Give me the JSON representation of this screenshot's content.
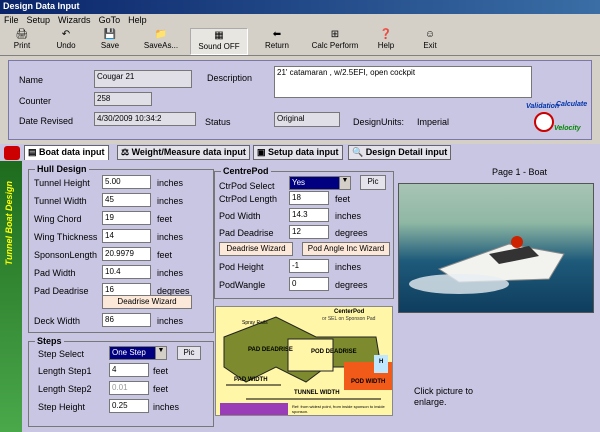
{
  "window": {
    "title": "Design Data Input"
  },
  "menu": [
    "File",
    "Setup",
    "Wizards",
    "GoTo",
    "Help"
  ],
  "toolbar": [
    {
      "label": "Print",
      "icon": "🖨"
    },
    {
      "label": "Undo",
      "icon": "↶"
    },
    {
      "label": "Save",
      "icon": "💾"
    },
    {
      "label": "SaveAs...",
      "icon": "📁"
    },
    {
      "label": "Sound OFF",
      "icon": "▦"
    },
    {
      "label": "Return",
      "icon": "⬅"
    },
    {
      "label": "Calc Perform",
      "icon": "⊞"
    },
    {
      "label": "Help",
      "icon": "❓"
    },
    {
      "label": "Exit",
      "icon": "☺"
    }
  ],
  "header": {
    "name_label": "Name",
    "name_value": "Cougar 21",
    "counter_label": "Counter",
    "counter_value": "258",
    "date_label": "Date Revised",
    "date_value": "4/30/2009 10:34:2",
    "description_label": "Description",
    "description_value": "21' catamaran , w/2.5EFI, open cockpit",
    "status_label": "Status",
    "status_value": "Original",
    "units_label": "DesignUnits:",
    "units_value": "Imperial",
    "logo_text_1": "Validation",
    "logo_text_2": "Calculate",
    "logo_text_3": "Velocity"
  },
  "tabs": [
    "Boat data input",
    "Weight/Measure data input",
    "Setup data input",
    "Design Detail input"
  ],
  "sidebar_text": "Tunnel Boat Design",
  "hull": {
    "title": "Hull Design",
    "rows": [
      {
        "label": "Tunnel Height",
        "value": "5.00",
        "unit": "inches"
      },
      {
        "label": "Tunnel Width",
        "value": "45",
        "unit": "inches"
      },
      {
        "label": "Wing Chord",
        "value": "19",
        "unit": "feet"
      },
      {
        "label": "Wing Thickness",
        "value": "14",
        "unit": "inches"
      },
      {
        "label": "SponsonLength",
        "value": "20.9979",
        "unit": "feet"
      },
      {
        "label": "Pad Width",
        "value": "10.4",
        "unit": "inches"
      },
      {
        "label": "Pad Deadrise",
        "value": "16",
        "unit": "degrees"
      }
    ],
    "deadrise_btn": "Deadrise Wizard",
    "deck_label": "Deck Width",
    "deck_value": "86",
    "deck_unit": "inches"
  },
  "steps": {
    "title": "Steps",
    "select_label": "Step Select",
    "select_value": "One Step",
    "pic_btn": "Pic",
    "rows": [
      {
        "label": "Length Step1",
        "value": "4",
        "unit": "feet"
      },
      {
        "label": "Length Step2",
        "value": "0.01",
        "unit": "feet"
      },
      {
        "label": "Step Height",
        "value": "0.25",
        "unit": "inches"
      }
    ]
  },
  "centrepod": {
    "title": "CentrePod",
    "select_label": "CtrPod Select",
    "select_value": "Yes",
    "pic_btn": "Pic",
    "rows": [
      {
        "label": "CtrPod Length",
        "value": "18",
        "unit": "feet"
      },
      {
        "label": "Pod Width",
        "value": "14.3",
        "unit": "inches"
      },
      {
        "label": "Pad Deadrise",
        "value": "12",
        "unit": "degrees"
      }
    ],
    "deadrise_btn": "Deadrise Wizard",
    "angle_btn": "Pod Angle Inc Wizard",
    "rows2": [
      {
        "label": "Pod Height",
        "value": "-1",
        "unit": "inches"
      },
      {
        "label": "PodWangle",
        "value": "0",
        "unit": "degrees"
      }
    ]
  },
  "diagram": {
    "labels": [
      "CenterPod",
      "or SEL on Sponson Pad",
      "Spray Rails",
      "PAD DEADRISE",
      "POD DEADRISE",
      "PAD WIDTH",
      "POD WIDTH",
      "TUNNEL WIDTH",
      "Ref: from widest point, from inside sponson to inside sponson.",
      "H"
    ]
  },
  "photo": {
    "page_label": "Page 1 - Boat",
    "caption": "Click picture to enlarge."
  }
}
